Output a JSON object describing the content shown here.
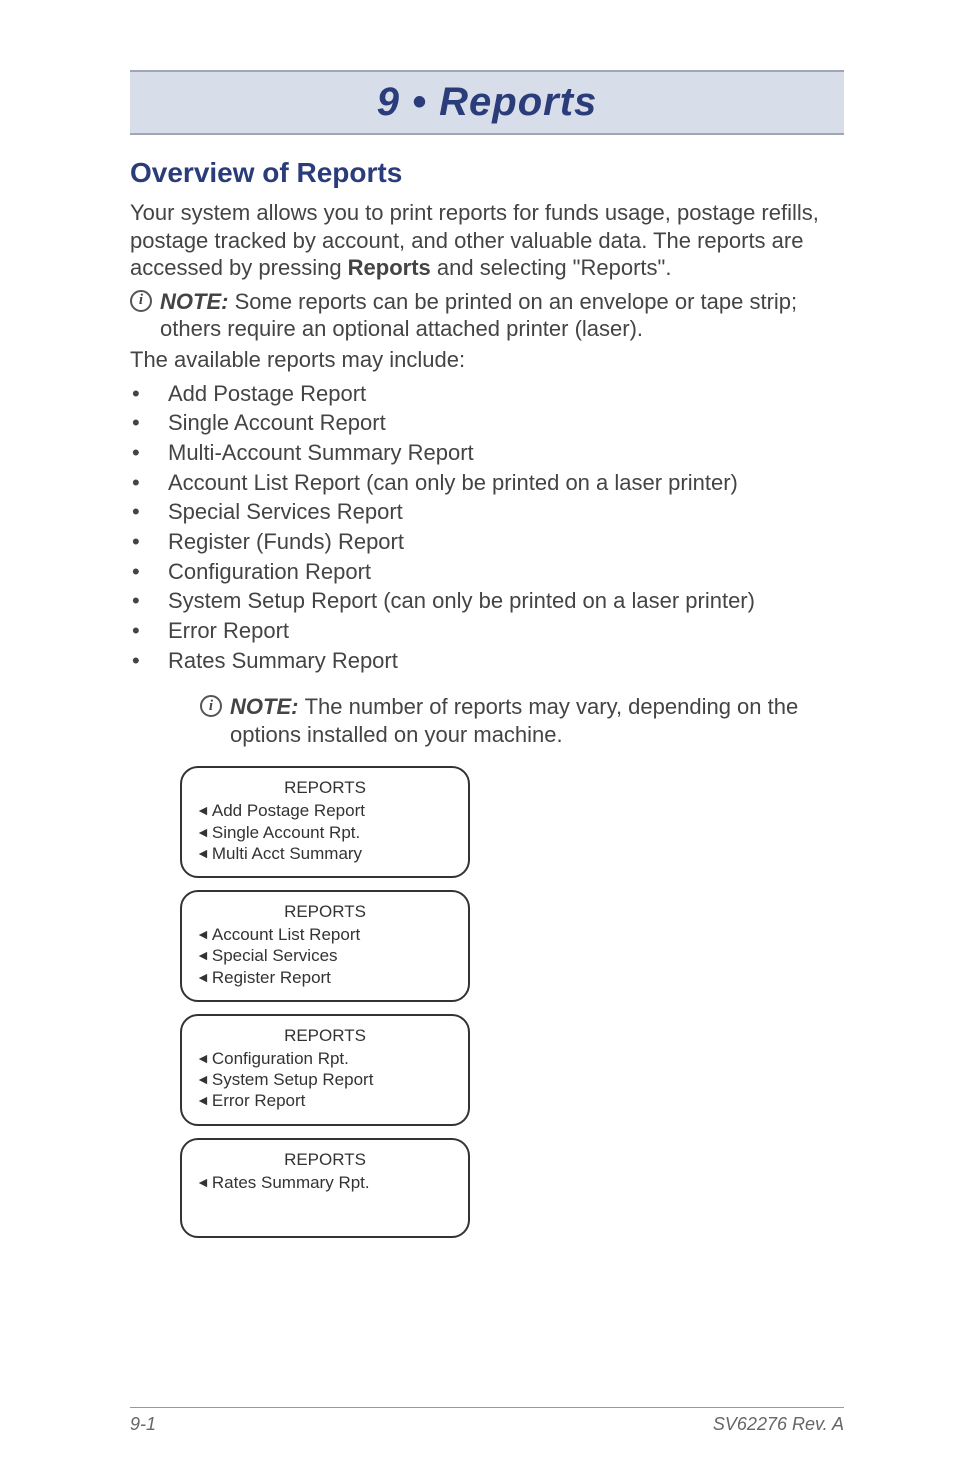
{
  "banner": {
    "title": "9 • Reports"
  },
  "heading": "Overview of Reports",
  "intro": {
    "pre": "Your system allows you to print reports for funds usage, postage refills, postage tracked by account, and other valuable data. The reports are accessed by pressing ",
    "bold": "Reports",
    "post": " and selecting \"Reports\"."
  },
  "note1": {
    "label": "NOTE",
    "sep": ": ",
    "text": "Some reports can be printed on an envelope or tape strip; others require an optional attached printer (laser)."
  },
  "available_line": "The available reports may include:",
  "report_items": [
    "Add Postage Report",
    "Single Account Report",
    "Multi-Account Summary Report",
    "Account List Report (can only be printed on a laser printer)",
    "Special Services Report",
    "Register (Funds) Report",
    "Configuration Report",
    "System Setup Report  (can only be printed on a laser printer)",
    "Error Report",
    "Rates Summary Report"
  ],
  "note2": {
    "label": "NOTE",
    "sep": ": ",
    "text": "The number of reports may vary, depending on the options installed on your machine."
  },
  "screens": [
    {
      "title": "REPORTS",
      "items": [
        "Add Postage Report",
        "Single Account Rpt.",
        "Multi Acct Summary"
      ]
    },
    {
      "title": "REPORTS",
      "items": [
        "Account List Report",
        "Special Services",
        "Register Report"
      ]
    },
    {
      "title": "REPORTS",
      "items": [
        "Configuration Rpt.",
        "System Setup Report",
        "Error Report"
      ]
    },
    {
      "title": "REPORTS",
      "items": [
        "Rates Summary Rpt."
      ]
    }
  ],
  "footer": {
    "left": "9-1",
    "right": "SV62276 Rev. A"
  },
  "glyphs": {
    "info": "i",
    "tri": "◄",
    "bullet": "•"
  }
}
